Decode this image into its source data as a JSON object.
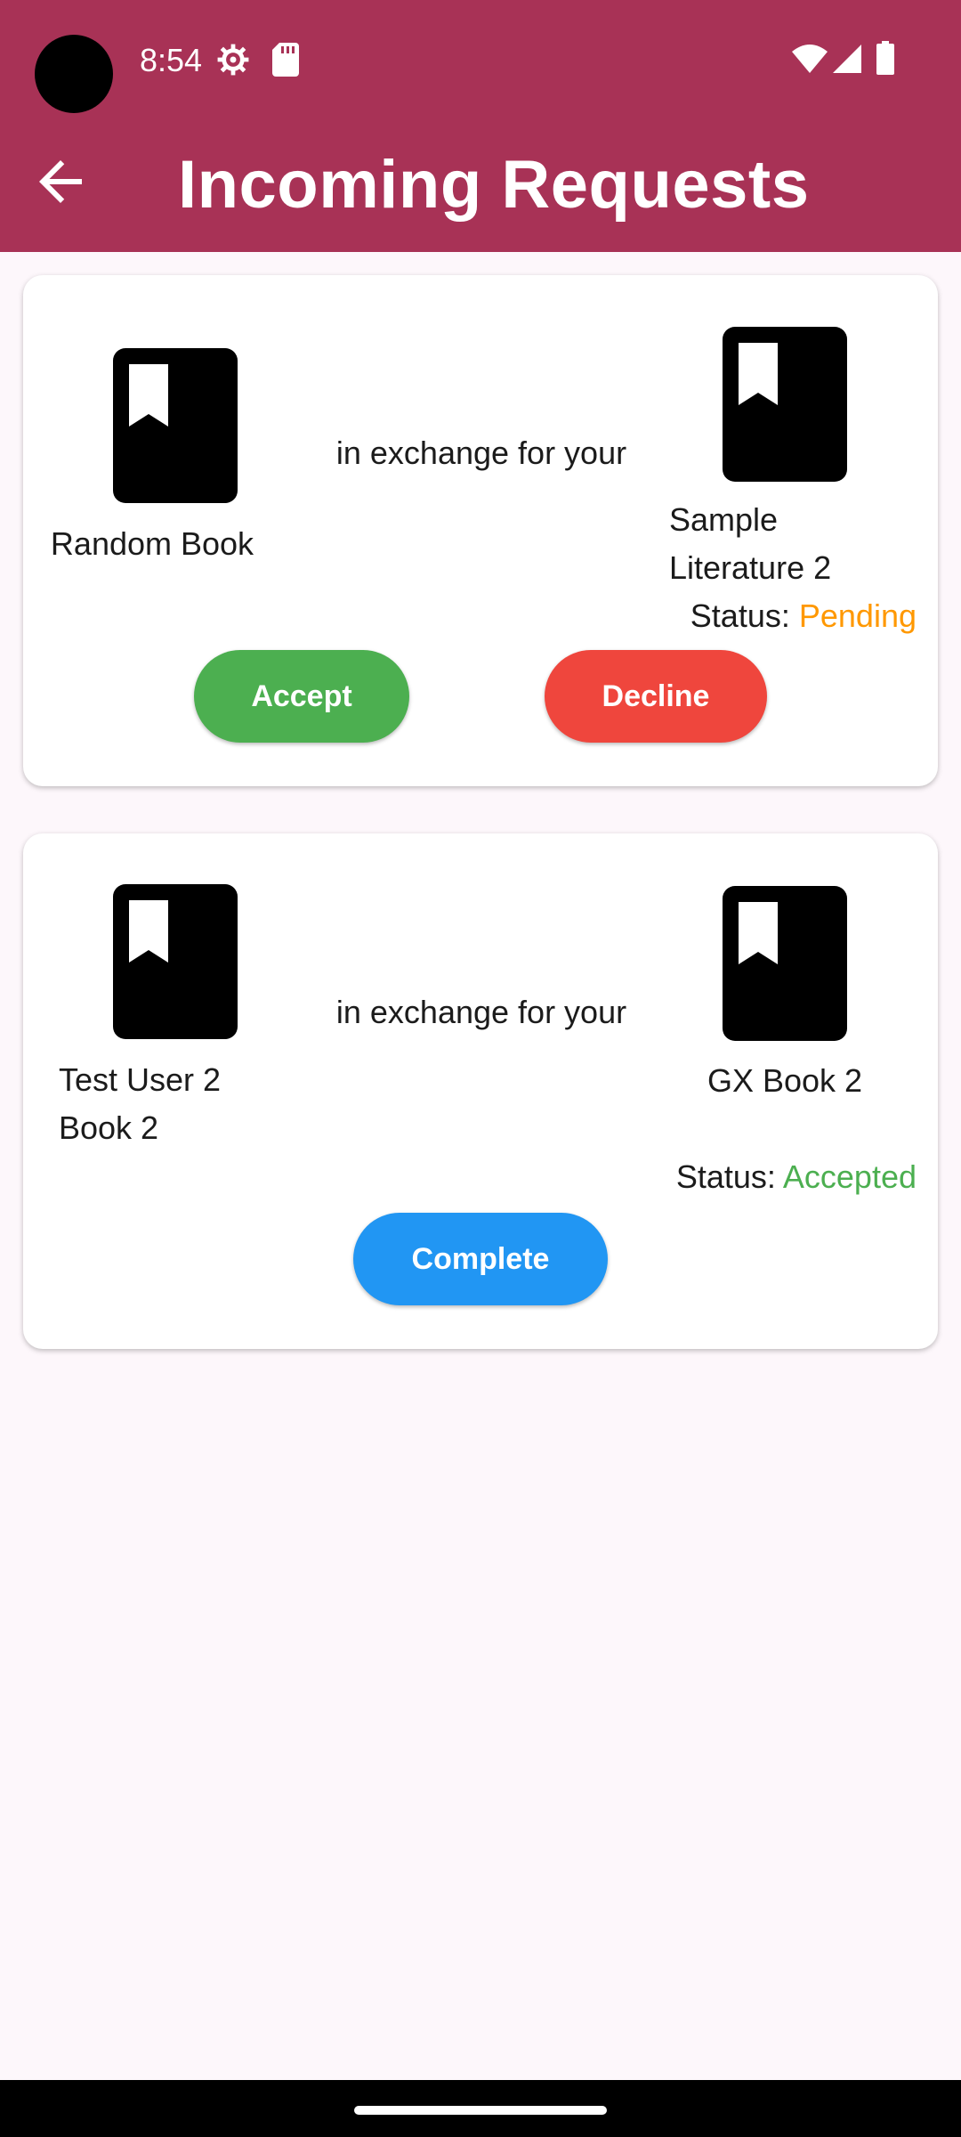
{
  "status_bar": {
    "time": "8:54",
    "icons": [
      "settings-icon",
      "sd-card-icon",
      "wifi-icon",
      "signal-icon",
      "battery-icon"
    ]
  },
  "app_bar": {
    "title": "Incoming Requests",
    "back_icon": "arrow-back-icon",
    "color": "#a83256"
  },
  "requests": [
    {
      "offered_book": "Random Book",
      "connector": "in exchange for your",
      "your_book": "Sample Literature 2",
      "status_label": "Status:",
      "status_value": "Pending",
      "status_color": "#ff9800",
      "actions": [
        "Accept",
        "Decline"
      ]
    },
    {
      "offered_book": "Test User 2 Book 2",
      "connector": "in exchange for your",
      "your_book": "GX Book 2",
      "status_label": "Status:",
      "status_value": "Accepted",
      "status_color": "#4caf50",
      "actions": [
        "Complete"
      ]
    }
  ],
  "colors": {
    "accept": "#4caf50",
    "decline": "#ef463d",
    "complete": "#2196f3"
  }
}
